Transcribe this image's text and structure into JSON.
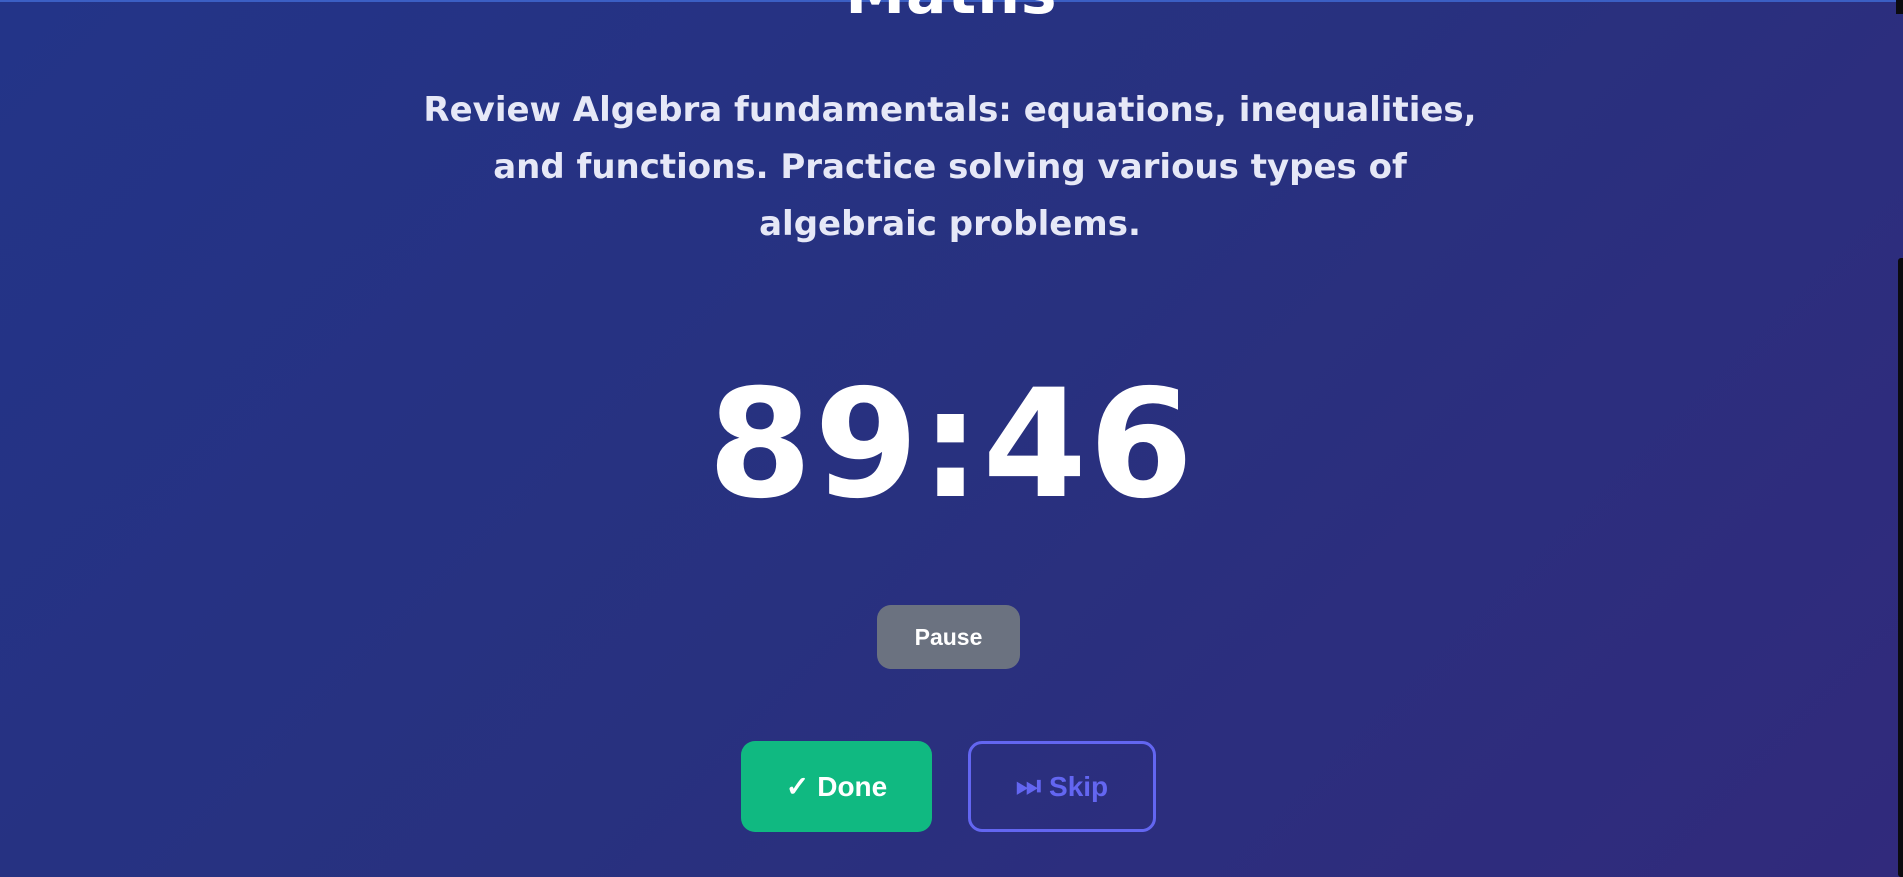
{
  "session": {
    "subject": "Maths",
    "description": "Review Algebra fundamentals: equations, inequalities, and functions. Practice solving various types of algebraic problems.",
    "timer": "89:46"
  },
  "controls": {
    "pause_label": "Pause",
    "done_icon": "✓",
    "done_label": "Done",
    "skip_icon": "⏭",
    "skip_label": "Skip"
  },
  "colors": {
    "background_start": "#233488",
    "background_end": "#312a7c",
    "pause": "#6b7280",
    "done": "#10b981",
    "skip": "#6366f1"
  },
  "icons": {
    "done": "checkmark-icon",
    "skip": "skip-forward-icon"
  }
}
